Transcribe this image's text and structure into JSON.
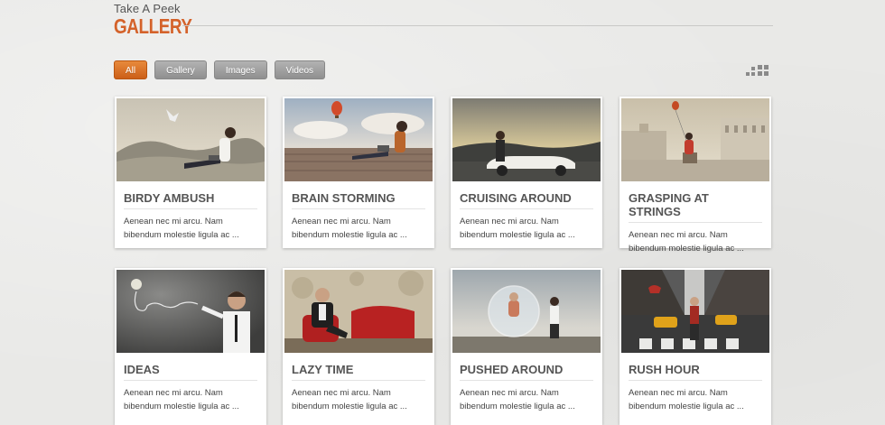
{
  "header": {
    "subtitle": "Take A Peek",
    "title": "GALLERY"
  },
  "filters": [
    {
      "label": "All",
      "active": true
    },
    {
      "label": "Gallery",
      "active": false
    },
    {
      "label": "Images",
      "active": false
    },
    {
      "label": "Videos",
      "active": false
    }
  ],
  "cards": [
    {
      "title": "BIRDY AMBUSH",
      "desc": "Aenean nec mi arcu. Nam bibendum molestie ligula ac ..."
    },
    {
      "title": "BRAIN STORMING",
      "desc": "Aenean nec mi arcu. Nam bibendum molestie ligula ac ..."
    },
    {
      "title": "CRUISING AROUND",
      "desc": "Aenean nec mi arcu. Nam bibendum molestie ligula ac ..."
    },
    {
      "title": "GRASPING AT STRINGS",
      "desc": "Aenean nec mi arcu. Nam bibendum molestie ligula ac ..."
    },
    {
      "title": "IDEAS",
      "desc": "Aenean nec mi arcu. Nam bibendum molestie ligula ac ..."
    },
    {
      "title": "LAZY TIME",
      "desc": "Aenean nec mi arcu. Nam bibendum molestie ligula ac ..."
    },
    {
      "title": "PUSHED AROUND",
      "desc": "Aenean nec mi arcu. Nam bibendum molestie ligula ac ..."
    },
    {
      "title": "RUSH HOUR",
      "desc": "Aenean nec mi arcu. Nam bibendum molestie ligula ac ..."
    }
  ],
  "icons": {
    "view_toggle": "grid-view-icon"
  },
  "colors": {
    "accent": "#d4622a",
    "active_filter": "#e07a2c",
    "filter_inactive": "#a0a0a0"
  }
}
